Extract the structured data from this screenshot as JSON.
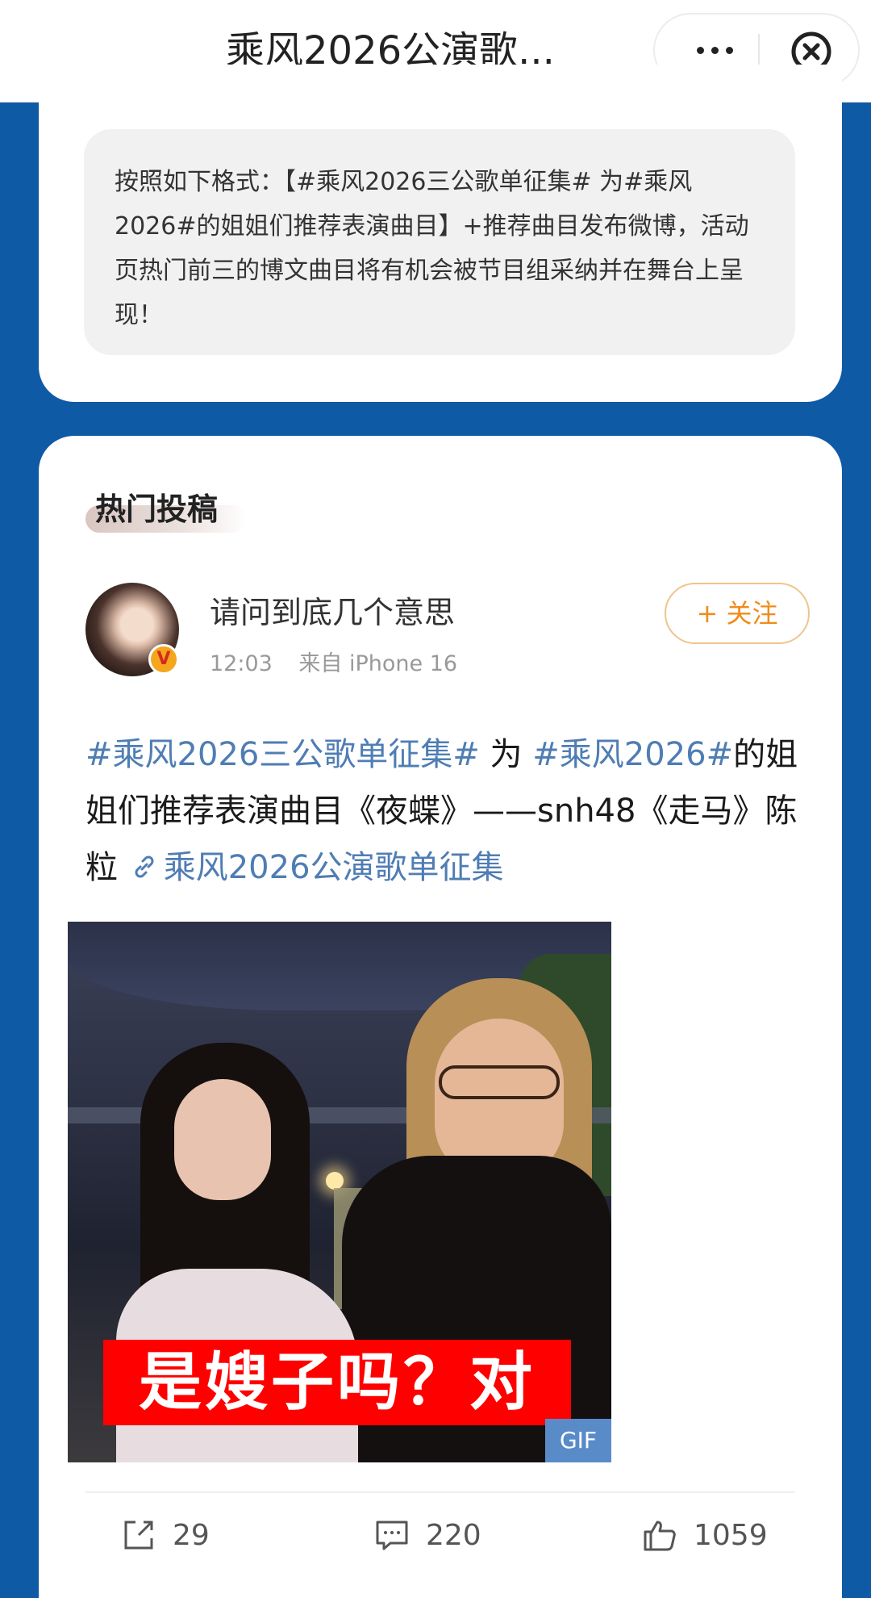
{
  "header": {
    "title": "乘风2026公演歌...",
    "more_icon": "more-dots-icon",
    "close_icon": "close-circle-icon"
  },
  "notice": {
    "text": "按照如下格式：【#乘风2026三公歌单征集# 为#乘风2026#的姐姐们推荐表演曲目】+推荐曲目发布微博，活动页热门前三的博文曲目将有机会被节目组采纳并在舞台上呈现！"
  },
  "section": {
    "title": "热门投稿"
  },
  "post": {
    "username": "请问到底几个意思",
    "time": "12:03",
    "source": "来自 iPhone 16",
    "verified_badge": "V",
    "follow_label": "+ 关注",
    "tag1": "#乘风2026三公歌单征集#",
    "text1": " 为 ",
    "tag2": "#乘风2026#",
    "text2": "的姐姐们推荐表演曲目《夜蝶》——snh48《走马》陈粒 ",
    "link": "乘风2026公演歌单征集",
    "image_caption": "是嫂子吗？对",
    "image_badge": "GIF"
  },
  "actions": {
    "share_count": "29",
    "comment_count": "220",
    "like_count": "1059"
  },
  "colors": {
    "page_background": "#0f5aa5",
    "link_blue": "#4f7db4",
    "follow_orange": "#f08c1a"
  }
}
